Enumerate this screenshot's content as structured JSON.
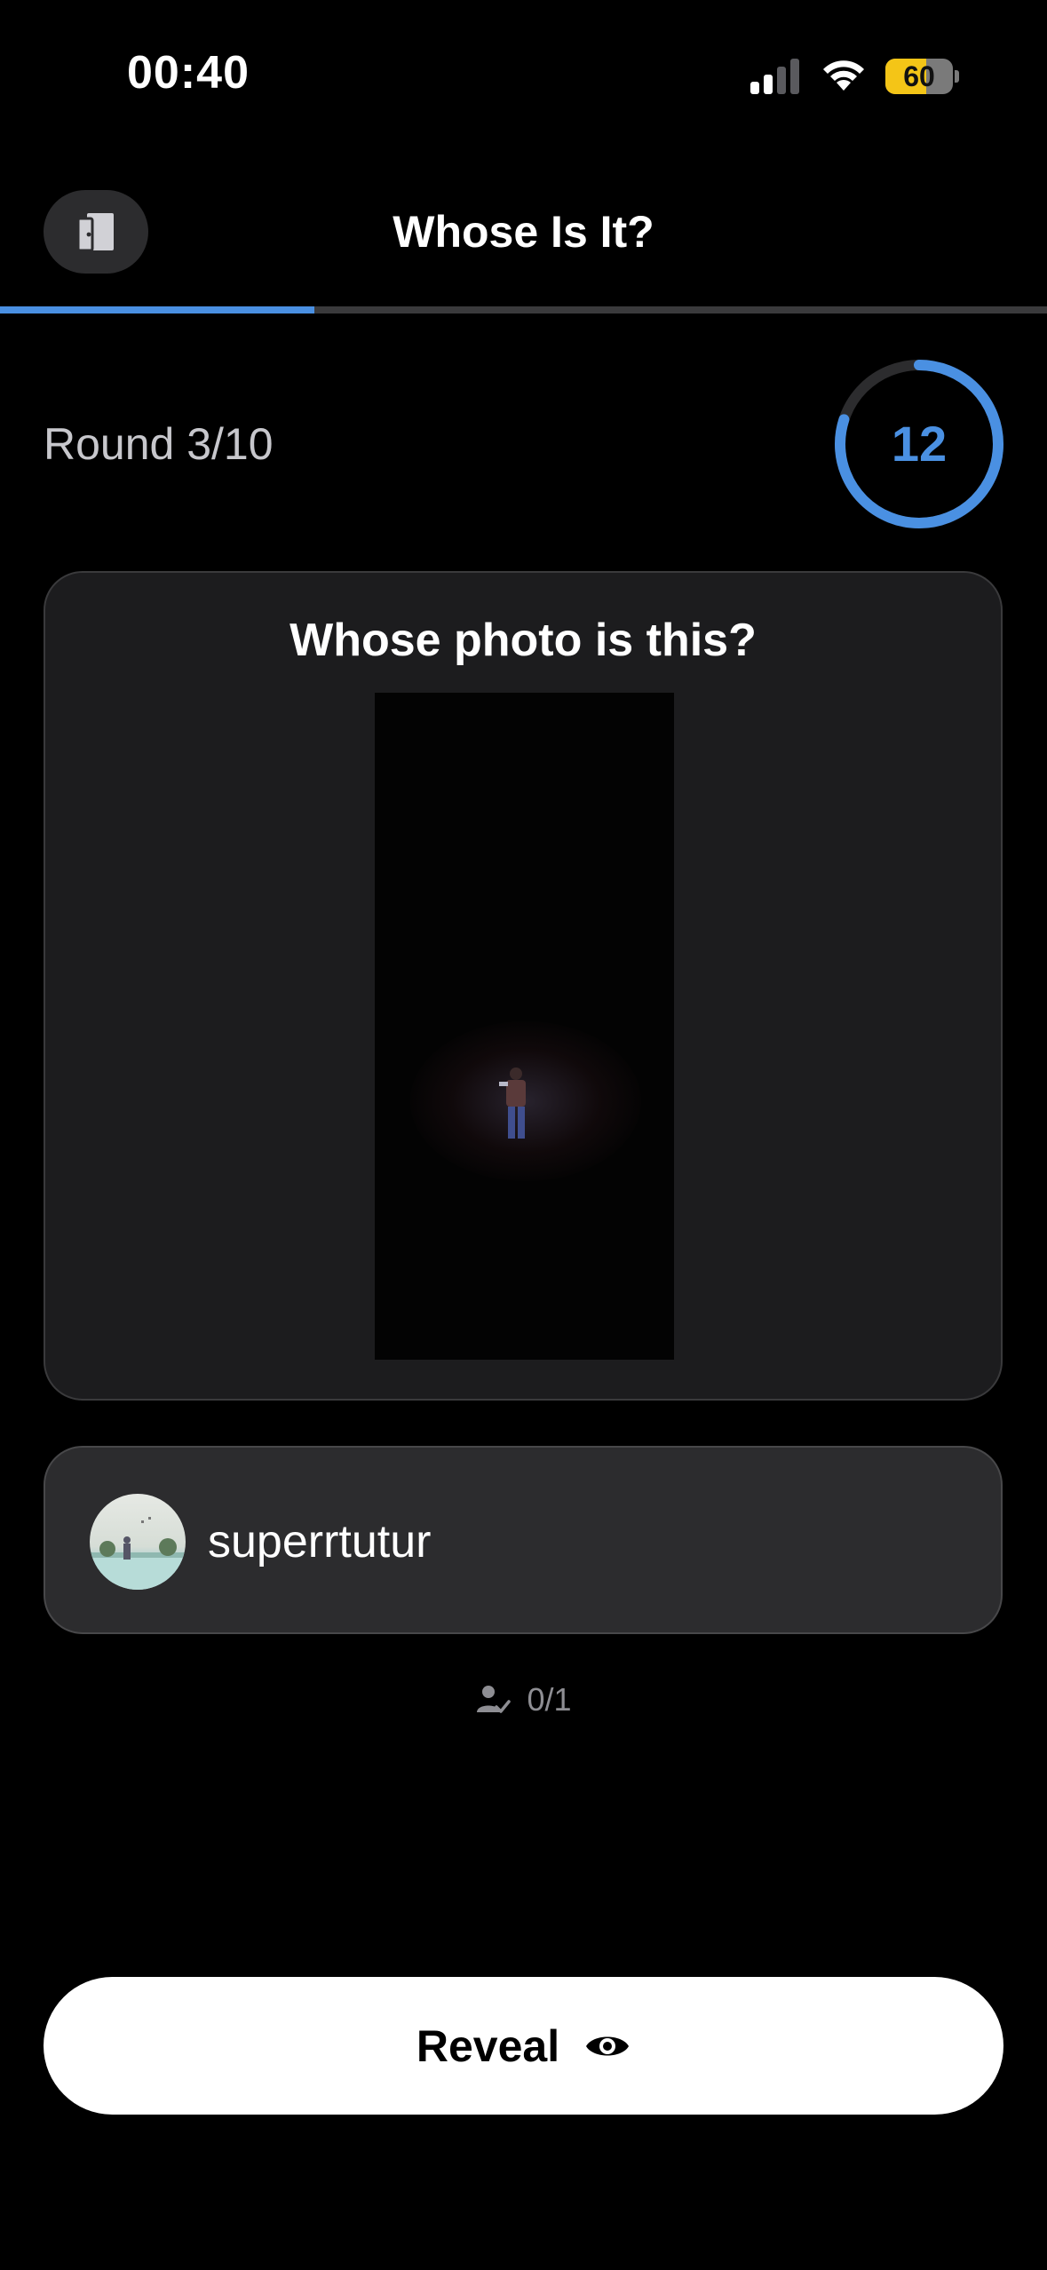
{
  "status_bar": {
    "time": "00:40",
    "battery_level": "60",
    "battery_fraction": 0.6,
    "icons": [
      "cellular-signal-icon",
      "wifi-icon",
      "battery-icon"
    ]
  },
  "header": {
    "title": "Whose Is It?",
    "leave_icon": "door-exit-icon",
    "progress_fraction": 0.3
  },
  "round": {
    "label": "Round 3/10",
    "timer_value": "12",
    "timer_fraction": 0.8
  },
  "question": {
    "text": "Whose photo is this?"
  },
  "options": [
    {
      "name": "superrtutur"
    }
  ],
  "answers": {
    "count": "0/1",
    "icon": "person-check-icon"
  },
  "reveal": {
    "label": "Reveal",
    "icon": "eye-icon"
  },
  "colors": {
    "accent": "#4a90e2",
    "background": "#000000",
    "card": "#1c1c1e",
    "battery": "#f4c517"
  }
}
